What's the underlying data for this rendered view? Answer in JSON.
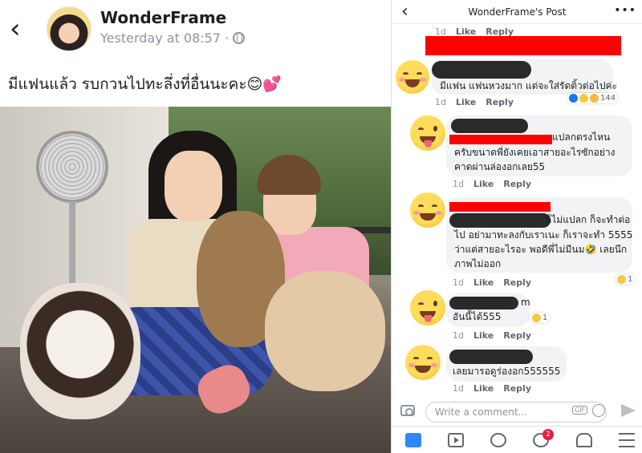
{
  "left": {
    "author": "WonderFrame",
    "timestamp": "Yesterday at 08:57 ·",
    "caption": "มีแฟนแล้ว รบกวนไปทะลึ่งที่อื่นนะคะ😊💕"
  },
  "right": {
    "header_title": "WonderFrame's Post",
    "more": "•••",
    "top_actions": {
      "time": "1d",
      "like": "Like",
      "reply": "Reply"
    },
    "comments": [
      {
        "lines": [
          "มีแฟน แฟนหวงมาก แต่จะใส่รัดติ้วต่อไปค่ะ"
        ],
        "time": "1d",
        "like": "Like",
        "reply": "Reply",
        "reaction_count": "144"
      },
      {
        "lines": [
          "แปลกตรงไหน",
          "ครับขนาดพี่ยังเคยเอาสายอะไรซักอย่าง",
          "คาดผ่านล่องอกเลย55"
        ],
        "time": "1d",
        "like": "Like",
        "reply": "Reply",
        "reaction_count": ""
      },
      {
        "lines": [
          "ก็ไม่แปลก ก็จะทำต่อ",
          "ไป อย่ามาทะลงกับเราเนะ ก็เราจะทำ 5555",
          "ว่าแต่สายอะไรอะ พอดีพี่ไม่มีนม🤣 เลยนึก",
          "ภาพไม่ออก"
        ],
        "time": "1d",
        "like": "Like",
        "reply": "Reply",
        "reaction_count": "1"
      },
      {
        "lines": [
          "m",
          "อันนี้ได้555"
        ],
        "time": "1d",
        "like": "Like",
        "reply": "Reply",
        "reaction_count": "1"
      },
      {
        "lines": [
          "เลยมารอดูร่องอก555555"
        ],
        "time": "1d",
        "like": "Like",
        "reply": "Reply",
        "reaction_count": ""
      }
    ],
    "composer_placeholder": "Write a comment...",
    "gif_label": "GIF",
    "tab_badge": "2"
  },
  "colors": {
    "redaction": "#ff0000",
    "dark_redaction": "#2a2a2a",
    "like_blue": "#1877f2",
    "bubble": "#f2f3f5"
  }
}
